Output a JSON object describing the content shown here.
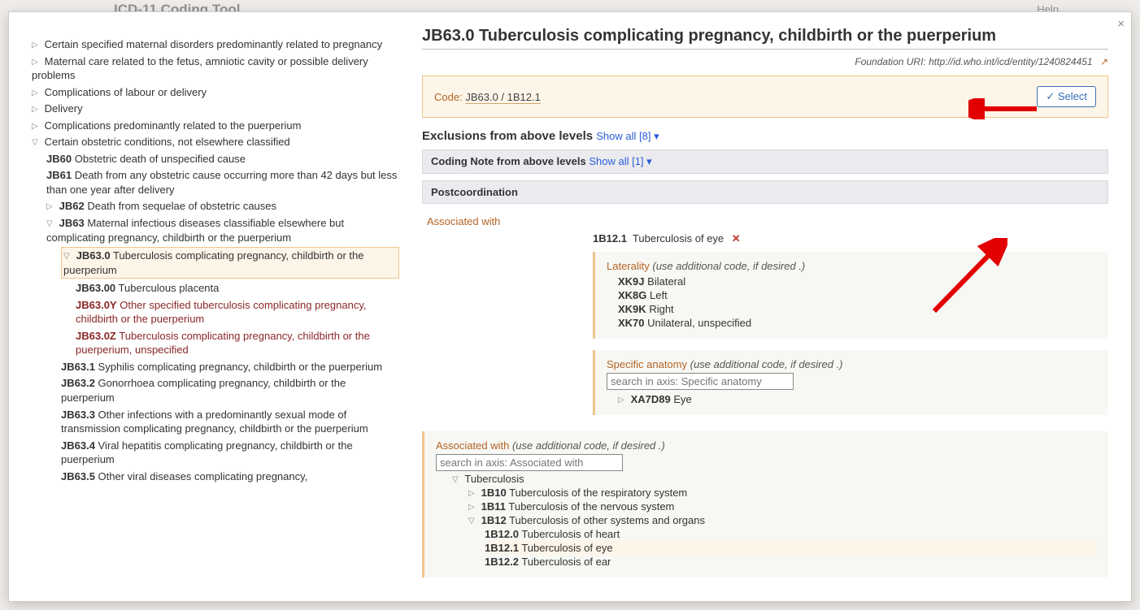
{
  "behind": {
    "title_fragment": "ICD-11 Coding Tool",
    "help": "Help"
  },
  "modal": {
    "close_label": "×"
  },
  "tree": {
    "n0": {
      "label": "Certain specified maternal disorders predominantly related to pregnancy"
    },
    "n1": {
      "label": "Maternal care related to the fetus, amniotic cavity or possible delivery problems"
    },
    "n2": {
      "label": "Complications of labour or delivery"
    },
    "n3": {
      "label": "Delivery"
    },
    "n4": {
      "label": "Complications predominantly related to the puerperium"
    },
    "n5": {
      "label": "Certain obstetric conditions, not elsewhere classified"
    },
    "jb60": {
      "code": "JB60",
      "label": "Obstetric death of unspecified cause"
    },
    "jb61": {
      "code": "JB61",
      "label": "Death from any obstetric cause occurring more than 42 days but less than one year after delivery"
    },
    "jb62": {
      "code": "JB62",
      "label": "Death from sequelae of obstetric causes"
    },
    "jb63": {
      "code": "JB63",
      "label": "Maternal infectious diseases classifiable elsewhere but complicating pregnancy, childbirth or the puerperium"
    },
    "jb630": {
      "code": "JB63.0",
      "label": "Tuberculosis complicating pregnancy, childbirth or the puerperium"
    },
    "jb6300": {
      "code": "JB63.00",
      "label": "Tuberculous placenta"
    },
    "jb630y": {
      "code": "JB63.0Y",
      "label": "Other specified tuberculosis complicating pregnancy, childbirth or the puerperium"
    },
    "jb630z": {
      "code": "JB63.0Z",
      "label": "Tuberculosis complicating pregnancy, childbirth or the puerperium, unspecified"
    },
    "jb631": {
      "code": "JB63.1",
      "label": "Syphilis complicating pregnancy, childbirth or the puerperium"
    },
    "jb632": {
      "code": "JB63.2",
      "label": "Gonorrhoea complicating pregnancy, childbirth or the puerperium"
    },
    "jb633": {
      "code": "JB63.3",
      "label": "Other infections with a predominantly sexual mode of transmission complicating pregnancy, childbirth or the puerperium"
    },
    "jb634": {
      "code": "JB63.4",
      "label": "Viral hepatitis complicating pregnancy, childbirth or the puerperium"
    },
    "jb635": {
      "code": "JB63.5",
      "label": "Other viral diseases complicating pregnancy,"
    }
  },
  "detail": {
    "title": "JB63.0 Tuberculosis complicating pregnancy, childbirth or the puerperium",
    "uri_label": "Foundation URI:",
    "uri": "http://id.who.int/icd/entity/1240824451",
    "code_label": "Code:",
    "code_value": "JB63.0 / 1B12.1",
    "select_label": "✓ Select",
    "excl_heading": "Exclusions from above levels",
    "excl_showall": "Show all [8]",
    "note_heading": "Coding Note from above levels",
    "note_showall": "Show all [1]",
    "pc_heading": "Postcoordination",
    "assoc_label": "Associated with",
    "sel_code": "1B12.1",
    "sel_label": "Tuberculosis of eye",
    "remove": "✕"
  },
  "laterality": {
    "title": "Laterality",
    "hint": "(use additional code, if desired .)",
    "opt1": {
      "code": "XK9J",
      "label": "Bilateral"
    },
    "opt2": {
      "code": "XK8G",
      "label": "Left"
    },
    "opt3": {
      "code": "XK9K",
      "label": "Right"
    },
    "opt4": {
      "code": "XK70",
      "label": "Unilateral, unspecified"
    }
  },
  "anatomy": {
    "title": "Specific anatomy",
    "hint": "(use additional code, if desired .)",
    "placeholder": "search in axis: Specific anatomy",
    "eye_code": "XA7D89",
    "eye_label": "Eye"
  },
  "assoc2": {
    "title": "Associated with",
    "hint": "(use additional code, if desired .)",
    "placeholder": "search in axis: Associated with",
    "root": "Tuberculosis",
    "b10": {
      "code": "1B10",
      "label": "Tuberculosis of the respiratory system"
    },
    "b11": {
      "code": "1B11",
      "label": "Tuberculosis of the nervous system"
    },
    "b12": {
      "code": "1B12",
      "label": "Tuberculosis of other systems and organs"
    },
    "b120": {
      "code": "1B12.0",
      "label": "Tuberculosis of heart"
    },
    "b121": {
      "code": "1B12.1",
      "label": "Tuberculosis of eye"
    },
    "b122": {
      "code": "1B12.2",
      "label": "Tuberculosis of ear"
    }
  }
}
